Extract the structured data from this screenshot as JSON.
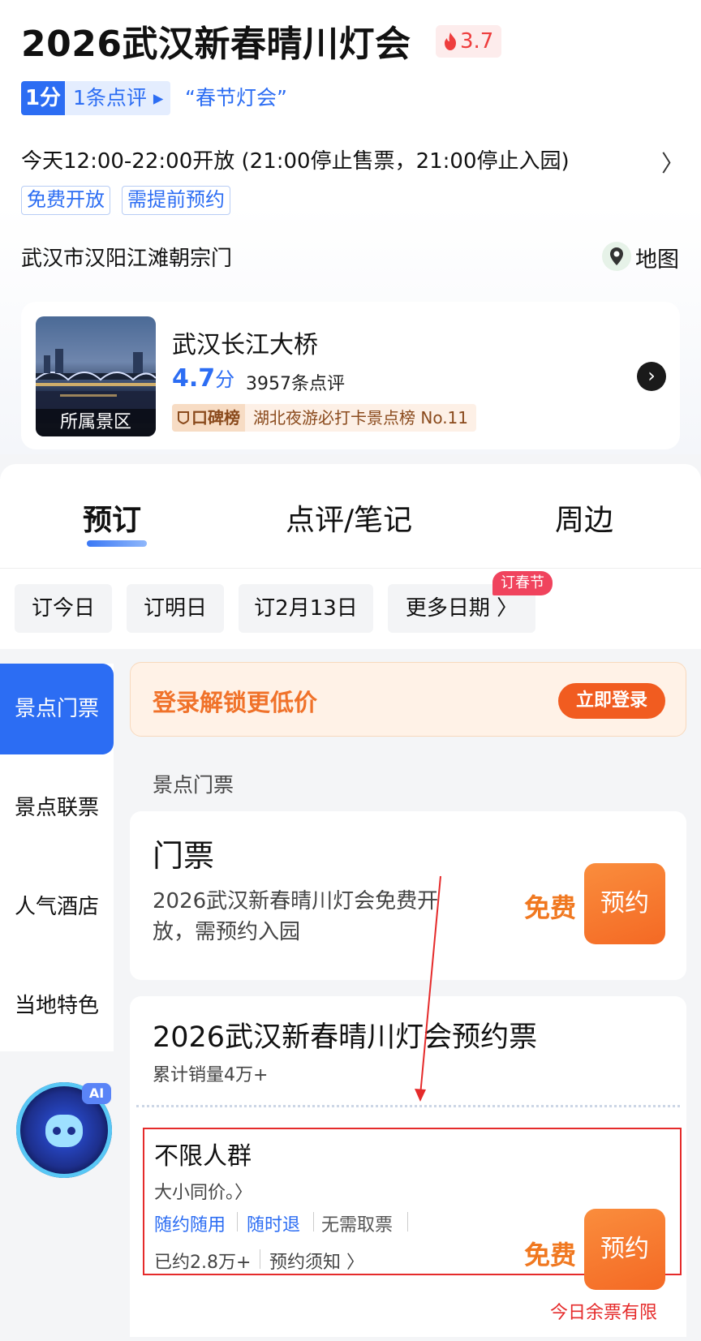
{
  "header": {
    "title": "2026武汉新春晴川灯会",
    "heat": "3.7",
    "score": "1分",
    "review_link": "1条点评 ▸",
    "quote_tag": "“春节灯会”",
    "hours": "今天12:00-22:00开放 (21:00停止售票，21:00停止入园)",
    "hours_arrow": "〉",
    "tags": [
      "免费开放",
      "需提前预约"
    ],
    "address": "武汉市汉阳江滩朝宗门",
    "map_label": "地图"
  },
  "scenic": {
    "thumb_label": "所属景区",
    "name": "武汉长江大桥",
    "score": "4.7",
    "score_unit": "分",
    "reviews": "3957条点评",
    "rank_badge": "口碑榜",
    "rank_text": "湖北夜游必打卡景点榜 No.11",
    "arrow": "›"
  },
  "tabs": [
    "预订",
    "点评/笔记",
    "周边"
  ],
  "dates": {
    "chips": [
      "订今日",
      "订明日",
      "订2月13日",
      "更多日期 〉"
    ],
    "festival_badge": "订春节"
  },
  "side_nav": {
    "active": "景点门票",
    "items": [
      "景点联票",
      "人气酒店",
      "当地特色"
    ],
    "ai_badge": "AI"
  },
  "login": {
    "text": "登录解锁更低价",
    "button": "立即登录"
  },
  "section_label": "景点门票",
  "ticket1": {
    "title": "门票",
    "desc": "2026武汉新春晴川灯会免费开放，需预约入园",
    "price": "免费",
    "button": "预约"
  },
  "ticket2": {
    "title": "2026武汉新春晴川灯会预约票",
    "sales": "累计销量4万+",
    "sub_title": "不限人群",
    "sub_desc": "大小同价。〉",
    "features": [
      "随约随用",
      "随时退",
      "无需取票"
    ],
    "booked": "已约2.8万+",
    "notice": "预约须知 〉",
    "price": "免费",
    "button": "预约",
    "remain": "今日余票有限"
  },
  "colors": {
    "brand_blue": "#2c6df3",
    "orange": "#f07820",
    "annotation_red": "#e52b2b"
  }
}
